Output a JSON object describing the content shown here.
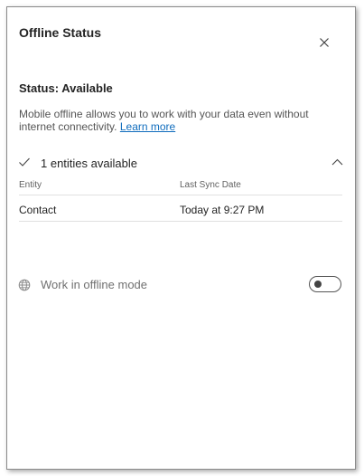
{
  "dialog": {
    "title": "Offline Status",
    "close_icon": "close-icon"
  },
  "status": {
    "heading": "Status: Available",
    "description": "Mobile offline allows you to work with your data even without internet connectivity.",
    "learn_more": "Learn more"
  },
  "entities": {
    "summary": "1 entities available",
    "expanded": true,
    "columns": [
      "Entity",
      "Last Sync Date"
    ],
    "rows": [
      {
        "entity": "Contact",
        "last_sync": "Today at 9:27 PM"
      }
    ]
  },
  "offline_mode": {
    "label": "Work in offline mode",
    "enabled": false,
    "icon": "globe-icon"
  },
  "colors": {
    "text": "#242424",
    "muted": "#707070",
    "link": "#0f6cbd",
    "divider": "#e0e0e0"
  }
}
